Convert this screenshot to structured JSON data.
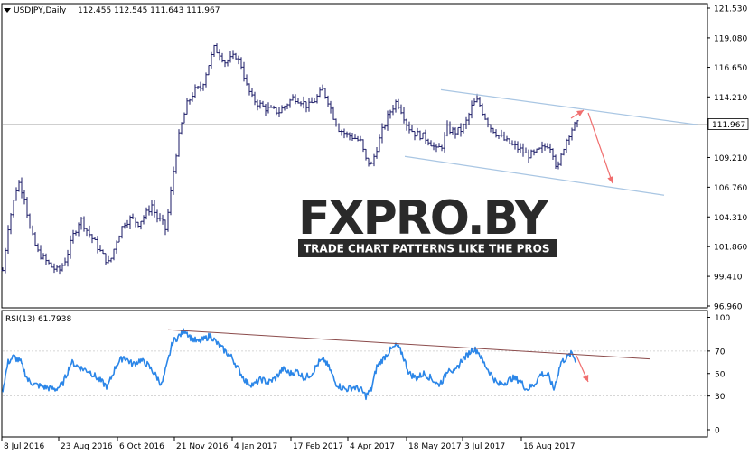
{
  "header": {
    "symbol_label": "USDJPY,Daily",
    "ohlc": "112.455 112.545 111.643 111.967",
    "rsi_label": "RSI(13) 61.7938"
  },
  "colors": {
    "bar": "#1a1a66",
    "rsi": "#2b86e8",
    "channel": "#a9c6e3",
    "rsi_trend": "#8b4b4b",
    "arrow": "#f06e6e",
    "grid": "#d8d8d8"
  },
  "watermark": {
    "brand": "FXPRO.BY",
    "tagline": "TRADE CHART PATTERNS LIKE THE PROS"
  },
  "chart_data": {
    "type": "line",
    "symbol": "USDJPY",
    "timeframe": "Daily",
    "price_axis": {
      "ticks": [
        "121.530",
        "119.080",
        "116.650",
        "114.210",
        "111.967",
        "109.210",
        "106.760",
        "104.310",
        "101.860",
        "99.410",
        "96.960"
      ],
      "current": "111.967"
    },
    "rsi_axis": {
      "ticks": [
        "100",
        "70",
        "50",
        "30",
        "0"
      ]
    },
    "x_ticks": [
      "8 Jul 2016",
      "23 Aug 2016",
      "6 Oct 2016",
      "21 Nov 2016",
      "4 Jan 2017",
      "17 Feb 2017",
      "4 Apr 2017",
      "18 May 2017",
      "3 Jul 2017",
      "16 Aug 2017"
    ],
    "price_path": [
      [
        0,
        99.9
      ],
      [
        6,
        103.5
      ],
      [
        12,
        105.6
      ],
      [
        17,
        107.3
      ],
      [
        24,
        106.0
      ],
      [
        30,
        103.3
      ],
      [
        38,
        101.5
      ],
      [
        46,
        100.8
      ],
      [
        54,
        100.2
      ],
      [
        62,
        99.8
      ],
      [
        70,
        100.9
      ],
      [
        78,
        102.8
      ],
      [
        86,
        104.2
      ],
      [
        94,
        103.1
      ],
      [
        102,
        102.2
      ],
      [
        110,
        101.2
      ],
      [
        118,
        100.4
      ],
      [
        126,
        102.4
      ],
      [
        134,
        103.8
      ],
      [
        142,
        104.2
      ],
      [
        150,
        103.8
      ],
      [
        158,
        104.5
      ],
      [
        165,
        105.3
      ],
      [
        170,
        104.3
      ],
      [
        176,
        103.9
      ],
      [
        180,
        103.3
      ],
      [
        184,
        105.1
      ],
      [
        190,
        108.7
      ],
      [
        196,
        111.4
      ],
      [
        204,
        113.6
      ],
      [
        212,
        114.7
      ],
      [
        220,
        115.0
      ],
      [
        228,
        116.9
      ],
      [
        234,
        118.2
      ],
      [
        240,
        117.8
      ],
      [
        246,
        117.1
      ],
      [
        252,
        117.3
      ],
      [
        258,
        117.6
      ],
      [
        264,
        116.8
      ],
      [
        270,
        115.1
      ],
      [
        276,
        114.1
      ],
      [
        282,
        113.7
      ],
      [
        290,
        113.3
      ],
      [
        298,
        113.1
      ],
      [
        306,
        113.0
      ],
      [
        314,
        113.6
      ],
      [
        322,
        114.2
      ],
      [
        330,
        113.9
      ],
      [
        338,
        113.4
      ],
      [
        346,
        114.0
      ],
      [
        354,
        114.8
      ],
      [
        360,
        113.9
      ],
      [
        366,
        112.6
      ],
      [
        372,
        111.6
      ],
      [
        380,
        111.1
      ],
      [
        388,
        110.9
      ],
      [
        396,
        110.5
      ],
      [
        402,
        109.0
      ],
      [
        408,
        108.6
      ],
      [
        414,
        110.0
      ],
      [
        420,
        111.4
      ],
      [
        428,
        112.9
      ],
      [
        436,
        113.9
      ],
      [
        442,
        113.0
      ],
      [
        448,
        111.8
      ],
      [
        456,
        111.2
      ],
      [
        464,
        111.0
      ],
      [
        472,
        110.6
      ],
      [
        480,
        109.8
      ],
      [
        486,
        110.2
      ],
      [
        492,
        111.6
      ],
      [
        500,
        111.3
      ],
      [
        508,
        111.5
      ],
      [
        514,
        112.3
      ],
      [
        520,
        113.6
      ],
      [
        526,
        113.9
      ],
      [
        532,
        112.8
      ],
      [
        540,
        111.7
      ],
      [
        548,
        111.1
      ],
      [
        556,
        110.6
      ],
      [
        564,
        110.2
      ],
      [
        572,
        109.9
      ],
      [
        580,
        109.4
      ],
      [
        588,
        109.5
      ],
      [
        596,
        109.9
      ],
      [
        604,
        110.3
      ],
      [
        608,
        109.9
      ],
      [
        614,
        108.1
      ],
      [
        620,
        109.9
      ],
      [
        626,
        111.1
      ],
      [
        632,
        111.8
      ],
      [
        637,
        112.0
      ]
    ],
    "rsi_path": [
      [
        0,
        36
      ],
      [
        6,
        60
      ],
      [
        12,
        65
      ],
      [
        20,
        60
      ],
      [
        28,
        44
      ],
      [
        36,
        40
      ],
      [
        46,
        38
      ],
      [
        58,
        36
      ],
      [
        66,
        40
      ],
      [
        76,
        60
      ],
      [
        86,
        55
      ],
      [
        96,
        52
      ],
      [
        106,
        45
      ],
      [
        116,
        38
      ],
      [
        126,
        58
      ],
      [
        134,
        65
      ],
      [
        144,
        58
      ],
      [
        152,
        62
      ],
      [
        160,
        58
      ],
      [
        168,
        50
      ],
      [
        176,
        40
      ],
      [
        182,
        58
      ],
      [
        188,
        78
      ],
      [
        196,
        84
      ],
      [
        202,
        89
      ],
      [
        208,
        82
      ],
      [
        216,
        78
      ],
      [
        222,
        80
      ],
      [
        230,
        84
      ],
      [
        238,
        76
      ],
      [
        246,
        70
      ],
      [
        254,
        64
      ],
      [
        262,
        52
      ],
      [
        270,
        42
      ],
      [
        278,
        40
      ],
      [
        286,
        45
      ],
      [
        294,
        42
      ],
      [
        302,
        46
      ],
      [
        310,
        54
      ],
      [
        318,
        50
      ],
      [
        326,
        52
      ],
      [
        334,
        46
      ],
      [
        342,
        50
      ],
      [
        350,
        60
      ],
      [
        356,
        62
      ],
      [
        362,
        54
      ],
      [
        368,
        42
      ],
      [
        374,
        38
      ],
      [
        380,
        36
      ],
      [
        388,
        38
      ],
      [
        396,
        36
      ],
      [
        402,
        30
      ],
      [
        408,
        36
      ],
      [
        414,
        56
      ],
      [
        420,
        62
      ],
      [
        428,
        70
      ],
      [
        436,
        75
      ],
      [
        442,
        68
      ],
      [
        450,
        50
      ],
      [
        458,
        46
      ],
      [
        466,
        50
      ],
      [
        474,
        46
      ],
      [
        482,
        40
      ],
      [
        488,
        45
      ],
      [
        494,
        56
      ],
      [
        500,
        50
      ],
      [
        508,
        62
      ],
      [
        514,
        66
      ],
      [
        520,
        72
      ],
      [
        526,
        70
      ],
      [
        532,
        60
      ],
      [
        540,
        50
      ],
      [
        548,
        40
      ],
      [
        556,
        42
      ],
      [
        564,
        46
      ],
      [
        572,
        44
      ],
      [
        580,
        36
      ],
      [
        588,
        40
      ],
      [
        596,
        50
      ],
      [
        604,
        48
      ],
      [
        610,
        36
      ],
      [
        618,
        60
      ],
      [
        624,
        64
      ],
      [
        630,
        68
      ],
      [
        634,
        62
      ]
    ],
    "channel": {
      "upper": [
        [
          485,
          114.8
        ],
        [
          770,
          111.9
        ]
      ],
      "lower": [
        [
          445,
          109.3
        ],
        [
          732,
          106.1
        ]
      ]
    },
    "rsi_trendline": [
      [
        183,
        89
      ],
      [
        716,
        63
      ]
    ]
  }
}
